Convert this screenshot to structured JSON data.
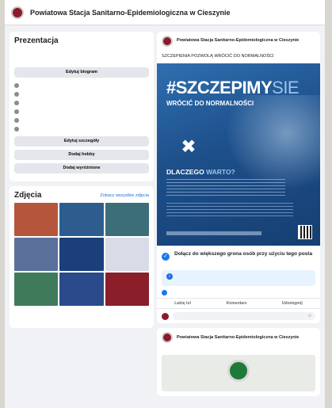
{
  "header": {
    "page_name": "Powiatowa Stacja Sanitarno-Epidemiologiczna w Cieszynie"
  },
  "intro": {
    "title": "Prezentacja",
    "description": "",
    "edit_bio_button": "Edytuj biogram",
    "rows": [
      {
        "icon": "flag-icon",
        "text": "",
        "link": false
      },
      {
        "icon": "link-icon",
        "text": "",
        "link": true
      },
      {
        "icon": "message-icon",
        "text": "",
        "link": false
      },
      {
        "icon": "link-icon",
        "text": "",
        "link": true
      },
      {
        "icon": "clock-icon",
        "text": "",
        "link": false
      },
      {
        "icon": "star-icon",
        "text": "",
        "link": false
      }
    ],
    "edit_details_button": "Edytuj szczegóły",
    "add_hobby_button": "Dodaj hobby",
    "add_featured_button": "Dodaj wyróżnione"
  },
  "photos": {
    "title": "Zdjęcia",
    "see_all": "Zobacz wszystkie zdjęcia",
    "thumbnail_colors": [
      "#b5563c",
      "#2d5d8f",
      "#3c6e7a",
      "#5a6f9a",
      "#1b3f7a",
      "#d8dce6",
      "#3f7b5a",
      "#2a4a8c",
      "#8a1f2a"
    ],
    "footer": ""
  },
  "post": {
    "author": "Powiatowa Stacja Sanitarno-Epidemiologiczna w Cieszynie",
    "meta": "",
    "text": "SZCZEPIENIA POZWOLĄ WRÓCIĆ DO NORMALNOŚCI",
    "poster": {
      "hashtag": "#SZCZEPIMY",
      "hashtag_suffix": "SIE",
      "subline_dim": "",
      "subline": "WRÓCIĆ DO NORMALNOŚCI",
      "why_a": "DLACZEGO",
      "why_b": "WARTO?"
    },
    "join_title": "Dołącz do większego grona osób przy użyciu tego posta",
    "join_description": "",
    "covid_info": "",
    "actions": {
      "like": "Lubię to!",
      "comment": "Komentarz",
      "share": "Udostępnij"
    },
    "comment_placeholder": ""
  },
  "post2": {
    "author": "Powiatowa Stacja Sanitarno-Epidemiologiczna w Cieszynie",
    "meta": "",
    "text": "",
    "image_caption": ""
  },
  "colors": {
    "brand": "#8b1a2b",
    "accent": "#1877f2",
    "poster_blue": "#1d4f8a"
  }
}
